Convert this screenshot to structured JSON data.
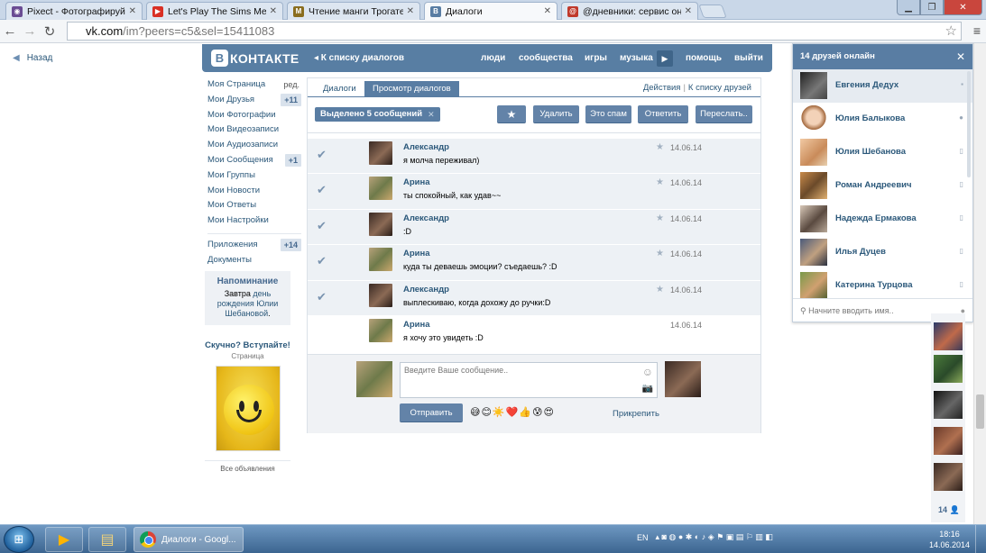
{
  "browser": {
    "tabs": [
      {
        "title": "Pixect - Фотографируйте",
        "icon": "pixect-icon",
        "color": "#6a4c93",
        "active": false
      },
      {
        "title": "Let's Play The Sims Medieval",
        "icon": "youtube-icon",
        "color": "#d93025",
        "active": false
      },
      {
        "title": "Чтение манги Трогательный",
        "icon": "manga-icon",
        "color": "#8a6d1e",
        "active": false
      },
      {
        "title": "Диалоги",
        "icon": "vk-icon",
        "color": "#597da3",
        "active": true
      },
      {
        "title": "@дневники: сервис онлайн",
        "icon": "diary-icon",
        "color": "#c0392b",
        "active": false
      }
    ],
    "url_host": "vk.com",
    "url_path": "/im?peers=c5&sel=15411083"
  },
  "page": {
    "back_label": "Назад",
    "header": {
      "logo_letter": "В",
      "logo_text": "КОНТАКТЕ",
      "back_to_dialogs": "◂ К списку диалогов",
      "nav": [
        "люди",
        "сообщества",
        "игры",
        "музыка",
        "помощь",
        "выйти"
      ]
    },
    "left_menu": [
      {
        "label": "Моя Страница",
        "extra": "ред."
      },
      {
        "label": "Мои Друзья",
        "badge": "+11"
      },
      {
        "label": "Мои Фотографии"
      },
      {
        "label": "Мои Видеозаписи"
      },
      {
        "label": "Мои Аудиозаписи"
      },
      {
        "label": "Мои Сообщения",
        "badge": "+1"
      },
      {
        "label": "Мои Группы"
      },
      {
        "label": "Мои Новости"
      },
      {
        "label": "Мои Ответы"
      },
      {
        "label": "Мои Настройки"
      }
    ],
    "left_menu_extra": [
      {
        "label": "Приложения",
        "badge": "+14"
      },
      {
        "label": "Документы"
      }
    ],
    "reminder": {
      "title": "Напоминание",
      "text_before": "Завтра ",
      "text_link": "день рождения Юлии Шебановой",
      "text_after": "."
    },
    "ad": {
      "title": "Скучно? Вступайте!",
      "subtitle": "Страница",
      "all_ads": "Все объявления"
    },
    "dialog": {
      "tabs": [
        "Диалоги",
        "Просмотр диалогов"
      ],
      "actions_link": "Действия",
      "friends_link": "К списку друзей",
      "selected_label": "Выделено 5 сообщений",
      "buttons": [
        "Удалить",
        "Это спам",
        "Ответить",
        "Переслать.."
      ],
      "messages": [
        {
          "author": "Александр",
          "text": "я молча переживал)",
          "date": "14.06.14",
          "selected": true
        },
        {
          "author": "Арина",
          "text": "ты спокойный, как удав~~",
          "date": "14.06.14",
          "selected": true
        },
        {
          "author": "Александр",
          "text": ":D",
          "date": "14.06.14",
          "selected": true
        },
        {
          "author": "Арина",
          "text": "куда ты деваешь эмоции? съедаешь? :D",
          "date": "14.06.14",
          "selected": true
        },
        {
          "author": "Александр",
          "text": "выплескиваю, когда дохожу до ручки:D",
          "date": "14.06.14",
          "selected": true
        },
        {
          "author": "Арина",
          "text": "я хочу это увидеть :D",
          "date": "14.06.14",
          "selected": false
        }
      ],
      "compose_placeholder": "Введите Ваше сообщение..",
      "send_label": "Отправить",
      "attach_label": "Прикрепить",
      "smileys": "😅😊☀️❤️👍😰😍"
    },
    "friends_online": {
      "title": "14 друзей онлайн",
      "friends": [
        {
          "name": "Евгения Дедух",
          "status": "▪"
        },
        {
          "name": "Юлия Балыкова",
          "status": "●"
        },
        {
          "name": "Юлия Шебанова",
          "status": "▯"
        },
        {
          "name": "Роман Андреевич",
          "status": "▯"
        },
        {
          "name": "Надежда Ермакова",
          "status": "▯"
        },
        {
          "name": "Илья Дуцев",
          "status": "▯"
        },
        {
          "name": "Катерина Турцова",
          "status": "▯"
        }
      ],
      "search_placeholder": "Начните вводить имя..",
      "strip_count": "14 👤"
    }
  },
  "taskbar": {
    "active_window": "Диалоги - Googl...",
    "lang": "EN",
    "time": "18:16",
    "date": "14.06.2014"
  },
  "colors": {
    "vk_blue": "#597da3",
    "link": "#2b587a",
    "selected_row": "#edf1f5"
  }
}
